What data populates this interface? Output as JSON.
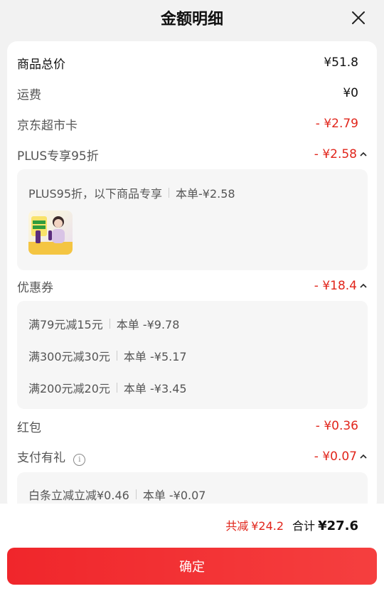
{
  "header": {
    "title": "金额明细"
  },
  "rows": {
    "goods": {
      "label": "商品总价",
      "amount": "¥51.8"
    },
    "shipping": {
      "label": "运费",
      "amount": "¥0"
    },
    "jdcard": {
      "label": "京东超市卡",
      "amount": "- ¥2.79"
    },
    "plus": {
      "label": "PLUS专享95折",
      "amount": "- ¥2.58"
    },
    "coupon": {
      "label": "优惠券",
      "amount": "- ¥18.4"
    },
    "redpacket": {
      "label": "红包",
      "amount": "- ¥0.36"
    },
    "pay": {
      "label": "支付有礼",
      "amount": "- ¥0.07"
    }
  },
  "plus_detail": {
    "desc": "PLUS95折，以下商品专享",
    "per_order": "本单-¥2.58"
  },
  "coupon_detail": [
    {
      "rule": "满79元减15元",
      "per_order": "本单 -¥9.78"
    },
    {
      "rule": "满300元减30元",
      "per_order": "本单 -¥5.17"
    },
    {
      "rule": "满200元减20元",
      "per_order": "本单 -¥3.45"
    }
  ],
  "pay_detail": {
    "rule": "白条立减立减¥0.46",
    "per_order": "本单 -¥0.07"
  },
  "summary": {
    "saved_label": "共减",
    "saved_value": "¥24.2",
    "total_label": "合计",
    "total_value": "¥27.6"
  },
  "confirm_label": "确定",
  "colors": {
    "accent": "#e1251b",
    "button": "#f0262b"
  },
  "icons": {
    "close": "close-icon",
    "chevron": "chevron-up-icon",
    "info": "info-icon"
  }
}
